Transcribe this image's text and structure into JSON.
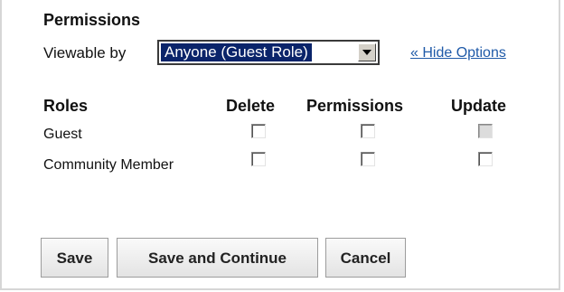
{
  "section_title": "Permissions",
  "viewable": {
    "label": "Viewable by",
    "selected": "Anyone (Guest Role)",
    "hide_options_link": "« Hide Options"
  },
  "table": {
    "headers": {
      "roles": "Roles",
      "delete": "Delete",
      "permissions": "Permissions",
      "update": "Update"
    },
    "rows": [
      {
        "role": "Guest",
        "delete": false,
        "permissions": false,
        "update": false,
        "update_disabled": true
      },
      {
        "role": "Community Member",
        "delete": false,
        "permissions": false,
        "update": false,
        "update_disabled": false
      }
    ]
  },
  "buttons": {
    "save": "Save",
    "save_continue": "Save and Continue",
    "cancel": "Cancel"
  },
  "colors": {
    "link": "#1f5aa8",
    "selection_highlight": "#0a246a"
  }
}
